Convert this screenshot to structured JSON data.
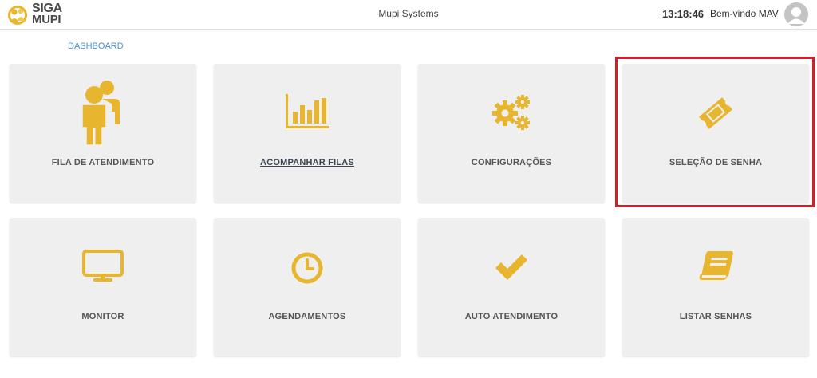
{
  "header": {
    "logo": {
      "line1": "SIGA",
      "line2": "MUPI"
    },
    "company_name": "Mupi Systems",
    "clock": "13:18:46",
    "welcome": "Bem-vindo MAV"
  },
  "breadcrumb": {
    "label": "DASHBOARD"
  },
  "colors": {
    "accent": "#e8b52f",
    "tile_bg": "#efefef",
    "highlight": "#d41f2b",
    "breadcrumb": "#4a90c8"
  },
  "tiles": [
    {
      "label": "FILA DE ATENDIMENTO",
      "icon": "people-icon"
    },
    {
      "label": "ACOMPANHAR FILAS",
      "icon": "bar-chart-icon"
    },
    {
      "label": "CONFIGURAÇÕES",
      "icon": "gears-icon"
    },
    {
      "label": "SELEÇÃO DE SENHA",
      "icon": "ticket-icon",
      "highlighted": true
    },
    {
      "label": "MONITOR",
      "icon": "monitor-icon"
    },
    {
      "label": "AGENDAMENTOS",
      "icon": "clock-icon"
    },
    {
      "label": "AUTO ATENDIMENTO",
      "icon": "checkmark-icon"
    },
    {
      "label": "LISTAR SENHAS",
      "icon": "book-icon"
    }
  ]
}
